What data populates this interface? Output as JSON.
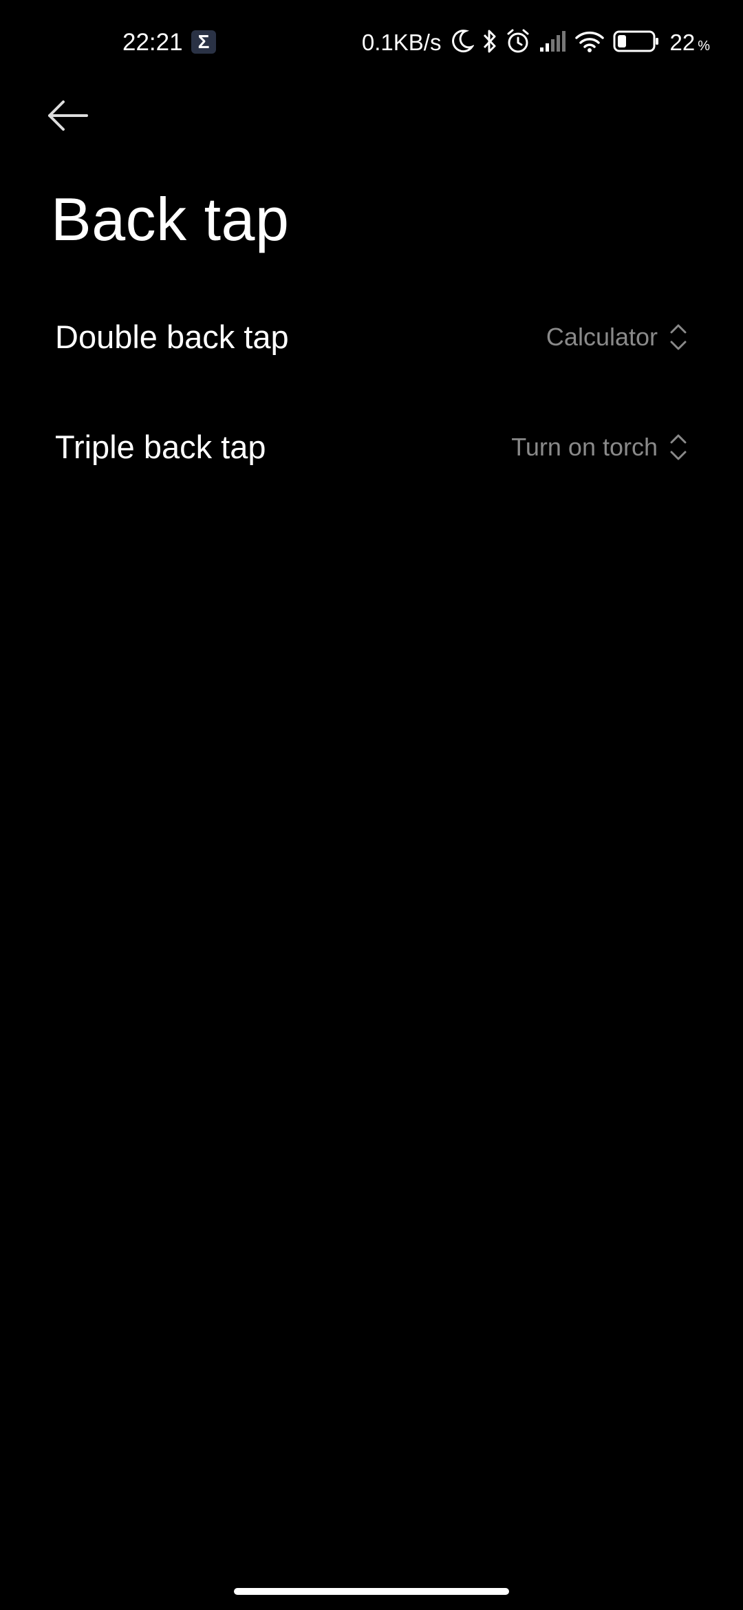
{
  "status_bar": {
    "time": "22:21",
    "badge": "Σ",
    "net_speed": "0.1KB/s",
    "battery_percent": "22",
    "battery_sign": "%",
    "icons": [
      "moon-icon",
      "bluetooth-icon",
      "alarm-icon",
      "signal-icon",
      "wifi-icon",
      "battery-icon"
    ]
  },
  "header": {
    "back_icon": "arrow-left-icon",
    "title": "Back tap"
  },
  "settings": [
    {
      "label": "Double back tap",
      "value": "Calculator"
    },
    {
      "label": "Triple back tap",
      "value": "Turn on torch"
    }
  ],
  "colors": {
    "background": "#000000",
    "text_primary": "#ffffff",
    "text_secondary": "#8a8a8a"
  }
}
